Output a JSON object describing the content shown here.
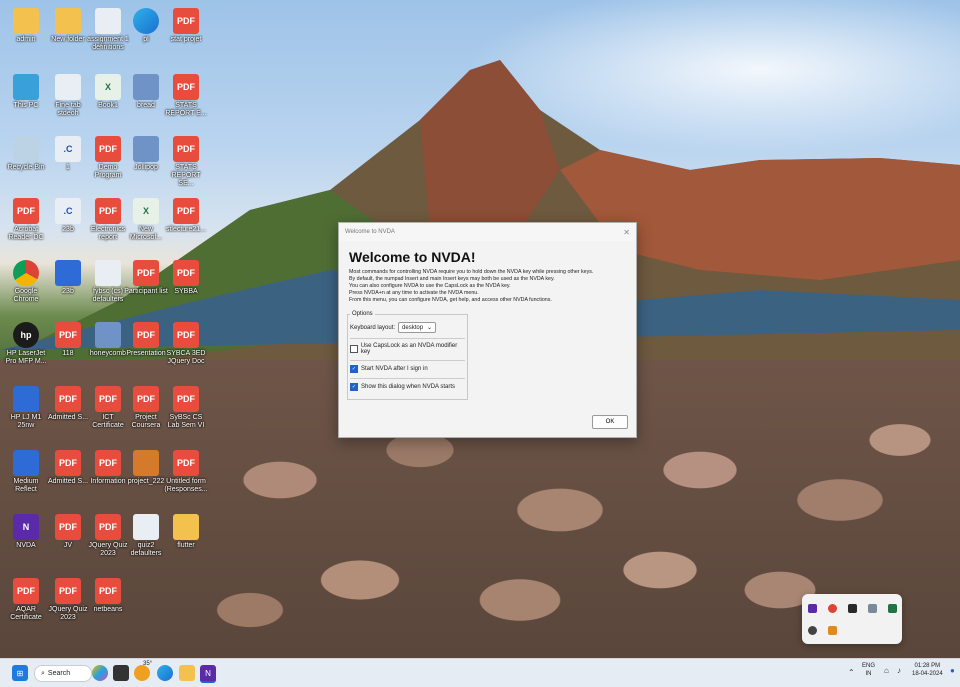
{
  "desktop_icons": [
    {
      "name": "admin",
      "label": "admin",
      "type": "folder"
    },
    {
      "name": "new-folder",
      "label": "New folder",
      "type": "folder"
    },
    {
      "name": "assignment",
      "label": "assignment 1 definitions",
      "type": "doc"
    },
    {
      "name": "pl",
      "label": "pl",
      "type": "edge"
    },
    {
      "name": "stat-projet",
      "label": "stat projet",
      "type": "pdf"
    },
    {
      "name": "this-pc",
      "label": "This PC",
      "type": "pc"
    },
    {
      "name": "fine-tab",
      "label": "Fine tab stdeoh",
      "type": "doc"
    },
    {
      "name": "book1",
      "label": "Book1",
      "type": "xls"
    },
    {
      "name": "bread",
      "label": "bread",
      "type": "img"
    },
    {
      "name": "stats-report-e",
      "label": "STATS REPORT E...",
      "type": "pdf"
    },
    {
      "name": "recycle-bin",
      "label": "Recycle Bin",
      "type": "bin"
    },
    {
      "name": "c-1",
      "label": "1",
      "type": "c"
    },
    {
      "name": "demo-program",
      "label": "Demo Program",
      "type": "pdf"
    },
    {
      "name": "jollipop",
      "label": "Jollipop",
      "type": "img"
    },
    {
      "name": "stats-report-se",
      "label": "STATS REPORT SE...",
      "type": "pdf"
    },
    {
      "name": "acrobat",
      "label": "Acrobat Reader DC",
      "type": "pdf"
    },
    {
      "name": "c-23b",
      "label": "23b",
      "type": "c"
    },
    {
      "name": "electronics-report",
      "label": "Electronics report",
      "type": "pdf"
    },
    {
      "name": "new-microsoft",
      "label": "New Microsof...",
      "type": "xls"
    },
    {
      "name": "stlecture21",
      "label": "stlecture21...",
      "type": "pdf"
    },
    {
      "name": "google-chrome",
      "label": "Google Chrome",
      "type": "chrome"
    },
    {
      "name": "app-23b",
      "label": "23b",
      "type": "blue"
    },
    {
      "name": "fybsc",
      "label": "fybsc (cs) defaulters",
      "type": "doc"
    },
    {
      "name": "participant-list",
      "label": "Participant list",
      "type": "pdf"
    },
    {
      "name": "sybba",
      "label": "SYBBA",
      "type": "pdf"
    },
    {
      "name": "hp-laserjet",
      "label": "HP LaserJet Pro MFP M...",
      "type": "hp"
    },
    {
      "name": "pdf-118",
      "label": "118",
      "type": "pdf"
    },
    {
      "name": "honeycomb",
      "label": "honeycomb",
      "type": "img"
    },
    {
      "name": "presentation",
      "label": "Presentation",
      "type": "pdf"
    },
    {
      "name": "sybca-jquery",
      "label": "SYBCA 3ED JQuery Doc",
      "type": "pdf"
    },
    {
      "name": "hp-lj-m1",
      "label": "HP LJ M1 25nw",
      "type": "blue"
    },
    {
      "name": "admitted-s",
      "label": "Admitted S...",
      "type": "pdf"
    },
    {
      "name": "ict-certificate",
      "label": "ICT Certificate",
      "type": "pdf"
    },
    {
      "name": "project-coursera",
      "label": "Project Coursera",
      "type": "pdf"
    },
    {
      "name": "sybsc-cs",
      "label": "SyBSc CS Lab Sem VI",
      "type": "pdf"
    },
    {
      "name": "medium-reflect",
      "label": "Medium Reflect",
      "type": "blue"
    },
    {
      "name": "admitted-s2",
      "label": "Admitted S...",
      "type": "pdf"
    },
    {
      "name": "information",
      "label": "Information",
      "type": "pdf"
    },
    {
      "name": "project-222",
      "label": "project_222",
      "type": "orange"
    },
    {
      "name": "untitled-form",
      "label": "Untitled form (Responses...",
      "type": "pdf"
    },
    {
      "name": "nvda",
      "label": "NVDA",
      "type": "nv"
    },
    {
      "name": "pdf-jv",
      "label": "JV",
      "type": "pdf"
    },
    {
      "name": "jquery-quiz",
      "label": "JQuery Quiz 2023",
      "type": "pdf"
    },
    {
      "name": "quiz2-defaulters",
      "label": "quiz2 defaulters",
      "type": "doc"
    },
    {
      "name": "flutter",
      "label": "flutter",
      "type": "folder"
    },
    {
      "name": "aqar-certificate",
      "label": "AQAR Certificate",
      "type": "pdf"
    },
    {
      "name": "jquery-quiz-2023",
      "label": "JQuery Quiz 2023",
      "type": "pdf"
    },
    {
      "name": "netbeans",
      "label": "netbeans",
      "type": "pdf"
    }
  ],
  "dialog": {
    "window_title": "Welcome to NVDA",
    "heading": "Welcome to NVDA!",
    "paragraphs": [
      "Most commands for controlling NVDA require you to hold down the NVDA key while pressing other keys.",
      "By default, the numpad Insert and main Insert keys may both be used as the NVDA key.",
      "You can also configure NVDA to use the CapsLock as the NVDA key.",
      "Press NVDA+n at any time to activate the NVDA menu.",
      "From this menu, you can configure NVDA, get help, and access other NVDA functions."
    ],
    "options_legend": "Options",
    "keyboard_layout_label": "Keyboard layout:",
    "keyboard_layout_value": "desktop",
    "checkboxes": [
      {
        "label": "Use CapsLock as an NVDA modifier key",
        "checked": false
      },
      {
        "label": "Start NVDA after I sign in",
        "checked": true
      },
      {
        "label": "Show this dialog when NVDA starts",
        "checked": true
      }
    ],
    "ok_label": "OK",
    "close_glyph": "✕"
  },
  "taskbar": {
    "search_label": "Search",
    "weather_temp": "35°",
    "lang_top": "ENG",
    "lang_bottom": "IN",
    "time": "01:28 PM",
    "date": "18-04-2024",
    "colors": {
      "accent": "#1f63c6",
      "taskbar_bg": "#e6ecf3"
    }
  }
}
